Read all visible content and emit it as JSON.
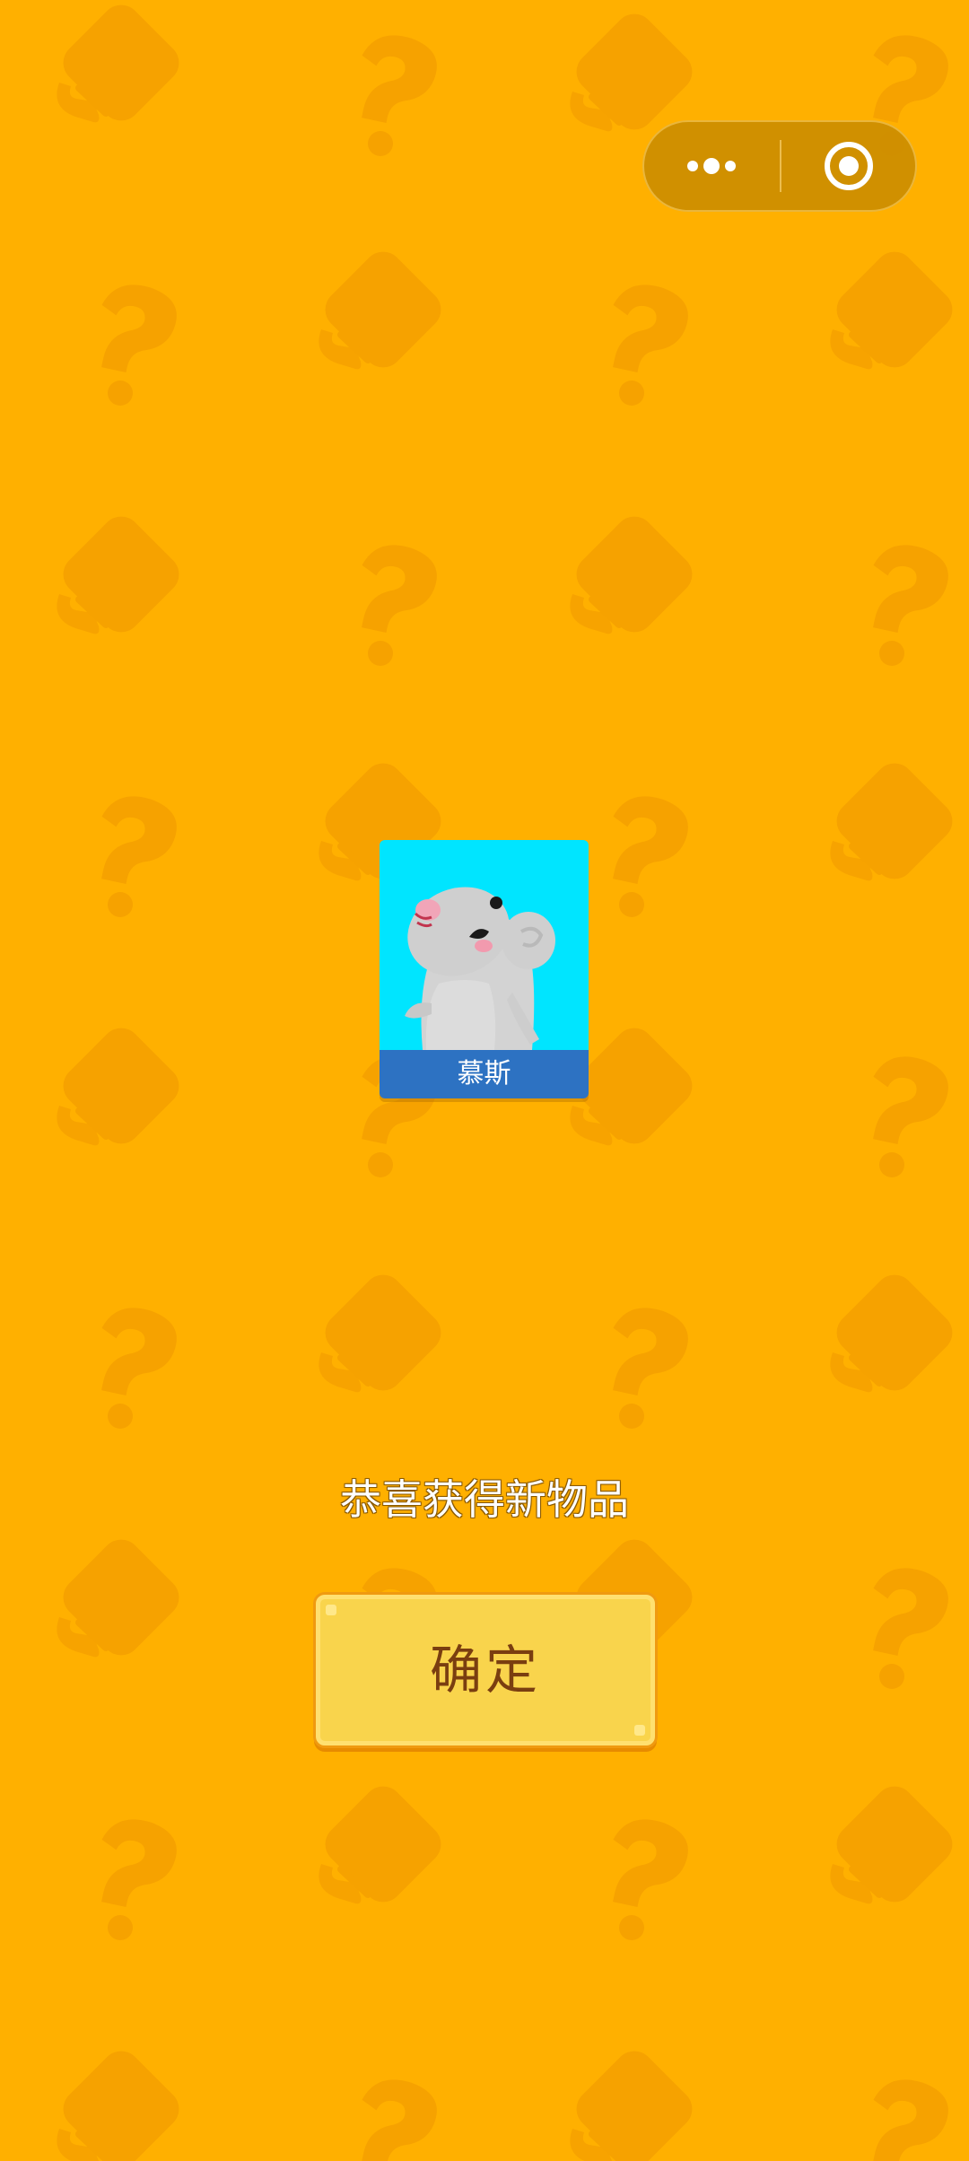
{
  "header": {
    "more_icon": "more-dots-icon",
    "close_icon": "target-circle-icon"
  },
  "item_card": {
    "name": "慕斯",
    "art": "grey-mouse-illustration"
  },
  "reward": {
    "message": "恭喜获得新物品"
  },
  "actions": {
    "confirm_label": "确定"
  },
  "colors": {
    "background": "#FFB000",
    "card_background": "#00E5FF",
    "card_name_bar": "#2D72C2",
    "button_fill": "#F9D44C",
    "button_text": "#7A3E10"
  }
}
